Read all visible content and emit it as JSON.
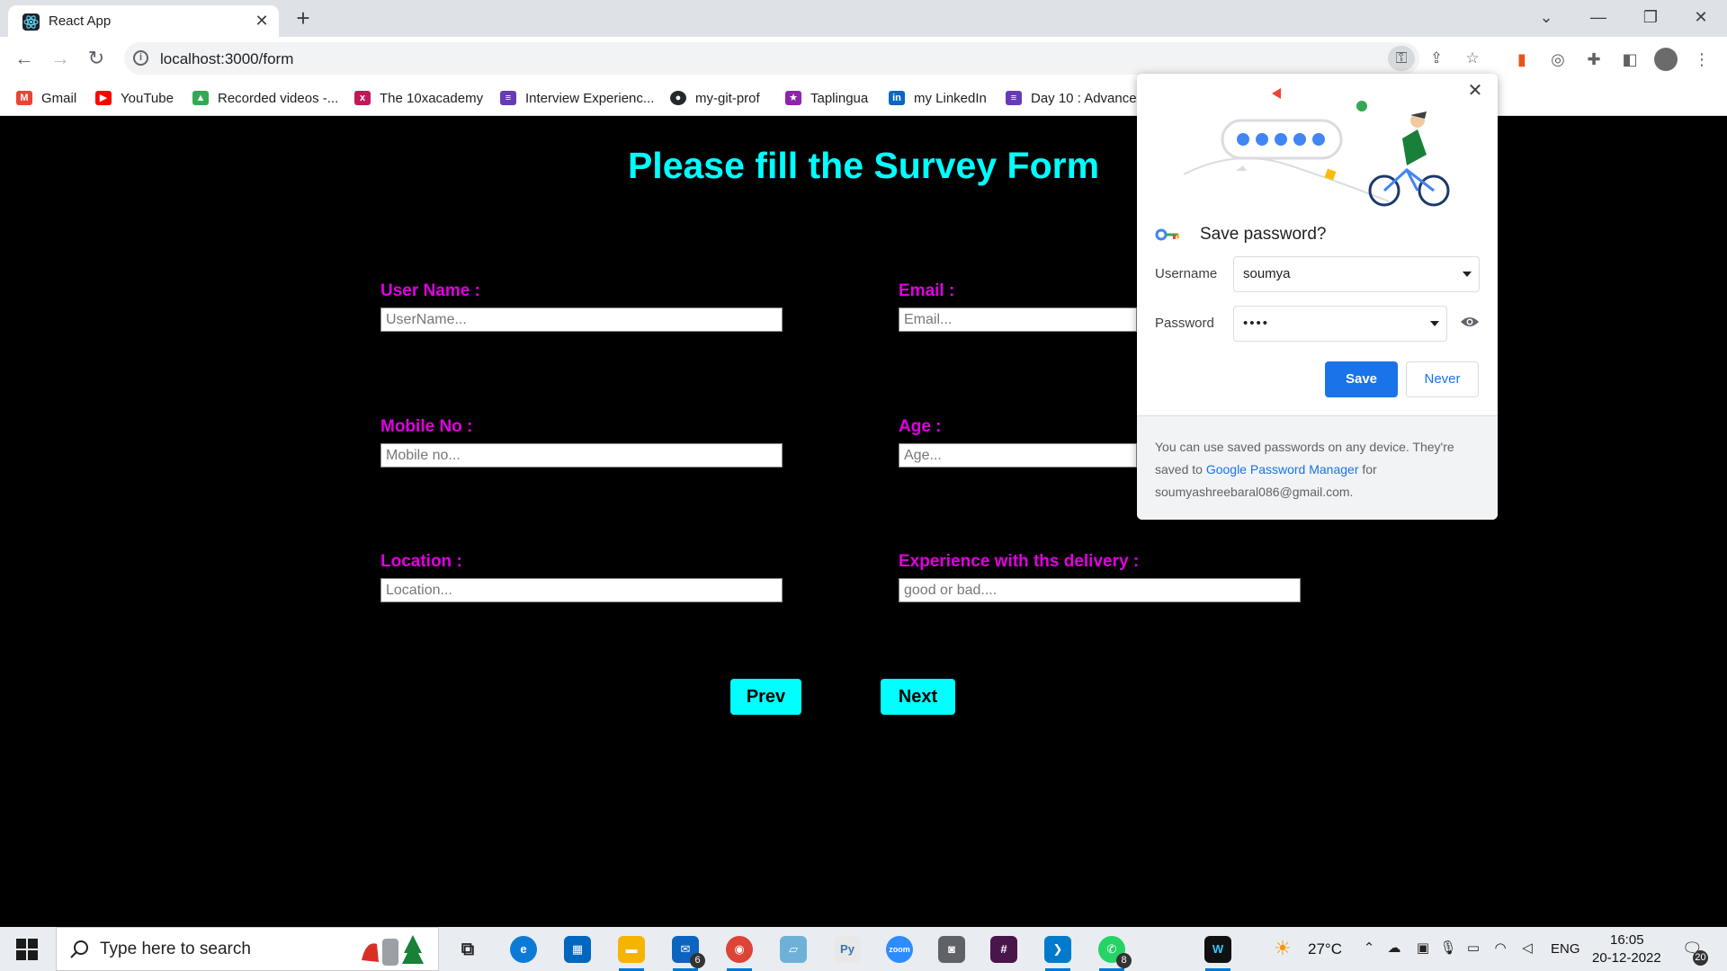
{
  "browser": {
    "tab_title": "React App",
    "tab_close": "✕",
    "new_tab": "+",
    "url": "localhost:3000/form",
    "bookmarks": [
      {
        "label": "Gmail",
        "color": "#ea4335",
        "glyph": "M"
      },
      {
        "label": "YouTube",
        "color": "#ff0000",
        "glyph": "▶"
      },
      {
        "label": "Recorded videos -...",
        "color": "#34a853",
        "glyph": "▲"
      },
      {
        "label": "The 10xacademy",
        "color": "#c2185b",
        "glyph": "x"
      },
      {
        "label": "Interview Experienc...",
        "color": "#673ab7",
        "glyph": "≡"
      },
      {
        "label": "my-git-prof",
        "color": "#24292e",
        "glyph": "●"
      },
      {
        "label": "Taplingua",
        "color": "#8e24aa",
        "glyph": "★"
      },
      {
        "label": "my LinkedIn",
        "color": "#0a66c2",
        "glyph": "in"
      },
      {
        "label": "Day 10 : Advance",
        "color": "#673ab7",
        "glyph": "≡"
      }
    ]
  },
  "form": {
    "title": "Please fill the Survey Form",
    "fields": {
      "username": {
        "label": "User Name :",
        "placeholder": "UserName..."
      },
      "email": {
        "label": "Email :",
        "placeholder": "Email..."
      },
      "mobile": {
        "label": "Mobile No :",
        "placeholder": "Mobile no..."
      },
      "age": {
        "label": "Age :",
        "placeholder": "Age..."
      },
      "location": {
        "label": "Location :",
        "placeholder": "Location..."
      },
      "experience": {
        "label": "Experience with ths delivery :",
        "placeholder": "good or bad...."
      }
    },
    "prev_label": "Prev",
    "next_label": "Next",
    "colors": {
      "title": "#00ffff",
      "label": "#e100e1",
      "button": "#00ffff",
      "background": "#000000"
    }
  },
  "password_popup": {
    "close": "✕",
    "title": "Save password?",
    "username_label": "Username",
    "username_value": "soumya",
    "password_label": "Password",
    "password_value": "••••",
    "save_label": "Save",
    "never_label": "Never",
    "footer_text_1": "You can use saved passwords on any device. They're saved to ",
    "footer_link": "Google Password Manager",
    "footer_text_2": " for",
    "footer_email": "soumyashreebaral086@gmail.com."
  },
  "taskbar": {
    "search_placeholder": "Type here to search",
    "weather": "27°C",
    "language": "ENG",
    "time": "16:05",
    "date": "20-12-2022",
    "mail_badge": "6",
    "whatsapp_badge": "8",
    "notification_badge": "20"
  }
}
